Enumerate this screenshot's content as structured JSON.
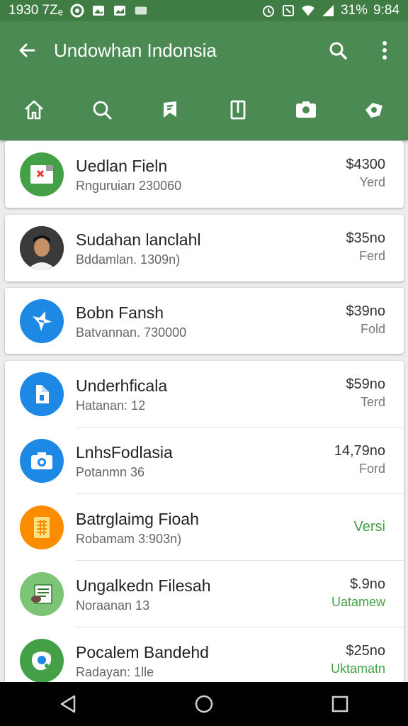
{
  "status_bar": {
    "time_left": "1930 7Zₑ",
    "battery": "31%",
    "clock": "9:84"
  },
  "app_bar": {
    "title": "Undowhan Indonsia"
  },
  "tabs": [
    {
      "icon": "home-icon"
    },
    {
      "icon": "search-icon"
    },
    {
      "icon": "bookmark-icon"
    },
    {
      "icon": "tablet-icon"
    },
    {
      "icon": "camera-icon"
    },
    {
      "icon": "share-icon"
    }
  ],
  "items": [
    {
      "name": "Uedlan Fieln",
      "sub": "Rnguruiarı 230060",
      "price": "$4300",
      "tag": "Yerd",
      "icon": "spreadsheet-app-icon",
      "icon_bg": "#43a047"
    },
    {
      "name": "Sudahan lanclahl",
      "sub": "Bddamlan. 1309n)",
      "price": "$35no",
      "tag": "Ferd",
      "icon": "profile-photo-icon",
      "icon_bg": "#2a2a2a"
    },
    {
      "name": "Bobn Fansh",
      "sub": "Batvannan. 730000",
      "price": "$39no",
      "tag": "Fold",
      "icon": "star-app-icon",
      "icon_bg": "#1e88e5"
    },
    {
      "name": "Underhficala",
      "sub": "Hatanan: 12",
      "price": "$59no",
      "tag": "Terd",
      "icon": "document-app-icon",
      "icon_bg": "#1e88e5"
    },
    {
      "name": "LnhsFodlasia",
      "sub": "Potanmn 36",
      "price": "14,79no",
      "tag": "Ford",
      "icon": "camera-app-icon",
      "icon_bg": "#1e88e5"
    },
    {
      "name": "Batrglaimg Fioah",
      "sub": "Robamam 3:903n)",
      "price": "",
      "tag": "Versi",
      "icon": "sheet-app-icon",
      "icon_bg": "#fb8c00"
    },
    {
      "name": "Ungalkedn Filesah",
      "sub": "Noraanan 13",
      "price": "$.9no",
      "tag": "Uatamew",
      "icon": "book-app-icon",
      "icon_bg": "#7cc576"
    },
    {
      "name": "Pocalem Bandehd",
      "sub": "Radayan: 1lle",
      "price": "$25no",
      "tag": "Uktamatn",
      "icon": "map-app-icon",
      "icon_bg": "#43a047"
    }
  ],
  "nav": [
    {
      "icon": "back-triangle-icon"
    },
    {
      "icon": "home-circle-icon"
    },
    {
      "icon": "recents-square-icon"
    }
  ]
}
